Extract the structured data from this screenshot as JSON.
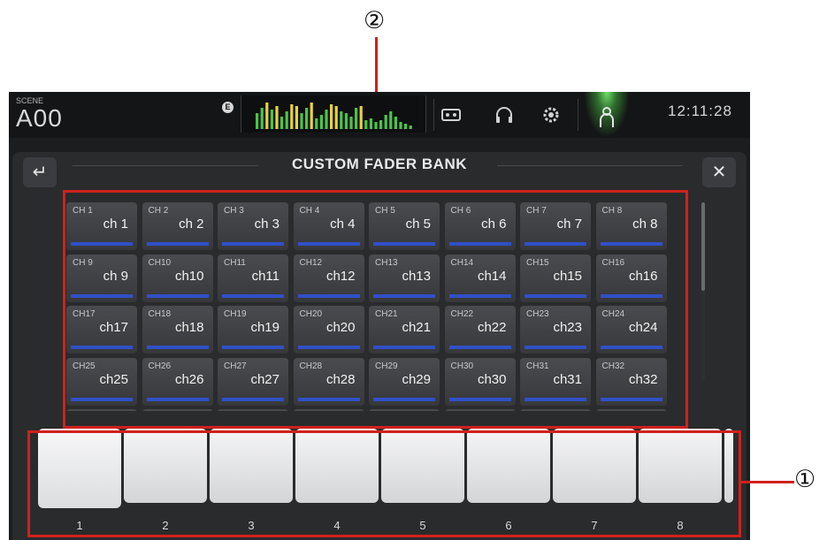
{
  "scene": {
    "label": "SCENE",
    "number": "A00"
  },
  "topbar": {
    "edit_badge": "E",
    "icons": [
      "recorder-icon",
      "headphones-icon",
      "settings-gear-icon",
      "user-icon"
    ],
    "clock": "12:11:28"
  },
  "dialog": {
    "title": "CUSTOM FADER BANK",
    "back_icon": "back-arrow-icon",
    "close_icon": "close-icon",
    "close_glyph": "✕",
    "back_glyph": "↵"
  },
  "channels": [
    {
      "num": "CH 1",
      "name": "ch 1"
    },
    {
      "num": "CH 2",
      "name": "ch 2"
    },
    {
      "num": "CH 3",
      "name": "ch 3"
    },
    {
      "num": "CH 4",
      "name": "ch 4"
    },
    {
      "num": "CH 5",
      "name": "ch 5"
    },
    {
      "num": "CH 6",
      "name": "ch 6"
    },
    {
      "num": "CH 7",
      "name": "ch 7"
    },
    {
      "num": "CH 8",
      "name": "ch 8"
    },
    {
      "num": "CH 9",
      "name": "ch 9"
    },
    {
      "num": "CH10",
      "name": "ch10"
    },
    {
      "num": "CH11",
      "name": "ch11"
    },
    {
      "num": "CH12",
      "name": "ch12"
    },
    {
      "num": "CH13",
      "name": "ch13"
    },
    {
      "num": "CH14",
      "name": "ch14"
    },
    {
      "num": "CH15",
      "name": "ch15"
    },
    {
      "num": "CH16",
      "name": "ch16"
    },
    {
      "num": "CH17",
      "name": "ch17"
    },
    {
      "num": "CH18",
      "name": "ch18"
    },
    {
      "num": "CH19",
      "name": "ch19"
    },
    {
      "num": "CH20",
      "name": "ch20"
    },
    {
      "num": "CH21",
      "name": "ch21"
    },
    {
      "num": "CH22",
      "name": "ch22"
    },
    {
      "num": "CH23",
      "name": "ch23"
    },
    {
      "num": "CH24",
      "name": "ch24"
    },
    {
      "num": "CH25",
      "name": "ch25"
    },
    {
      "num": "CH26",
      "name": "ch26"
    },
    {
      "num": "CH27",
      "name": "ch27"
    },
    {
      "num": "CH28",
      "name": "ch28"
    },
    {
      "num": "CH29",
      "name": "ch29"
    },
    {
      "num": "CH30",
      "name": "ch30"
    },
    {
      "num": "CH31",
      "name": "ch31"
    },
    {
      "num": "CH32",
      "name": "ch32"
    }
  ],
  "fader_bank": {
    "slots": [
      "1",
      "2",
      "3",
      "4",
      "5",
      "6",
      "7",
      "8"
    ],
    "selected_index": 0
  },
  "callouts": {
    "c1": "①",
    "c2": "②"
  },
  "colors": {
    "annotation": "#d0211c",
    "channel_bar": "#3050c8",
    "user_active": "#6fe06a"
  }
}
